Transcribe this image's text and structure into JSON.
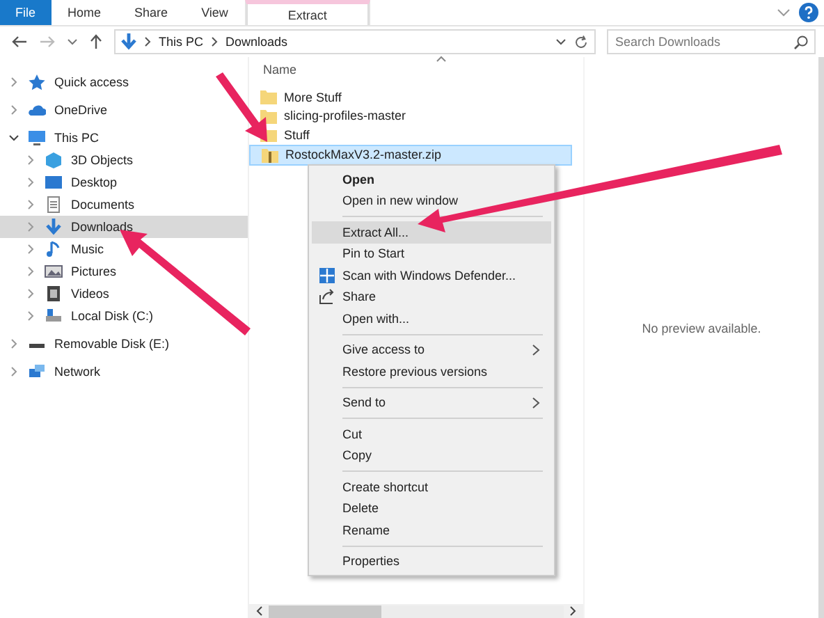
{
  "ribbon_tabs": [
    {
      "label": "File",
      "kind": "file",
      "selected": false
    },
    {
      "label": "Home",
      "kind": "tab",
      "selected": false
    },
    {
      "label": "Share",
      "kind": "tab",
      "selected": false
    },
    {
      "label": "View",
      "kind": "tab",
      "selected": false
    },
    {
      "label": "Extract",
      "kind": "contextual",
      "selected": true
    }
  ],
  "address_bar": {
    "path": [
      "This PC",
      "Downloads"
    ]
  },
  "search": {
    "placeholder": "Search Downloads"
  },
  "nav_pane": {
    "items": [
      {
        "label": "Quick access",
        "expanded": false,
        "selected": false
      },
      {
        "label": "OneDrive",
        "expanded": false,
        "selected": false
      },
      {
        "label": "This PC",
        "expanded": true,
        "selected": false,
        "children": [
          {
            "label": "3D Objects",
            "expanded": false,
            "selected": false
          },
          {
            "label": "Desktop",
            "expanded": false,
            "selected": false
          },
          {
            "label": "Documents",
            "expanded": false,
            "selected": false
          },
          {
            "label": "Downloads",
            "expanded": false,
            "selected": true
          },
          {
            "label": "Music",
            "expanded": false,
            "selected": false
          },
          {
            "label": "Pictures",
            "expanded": false,
            "selected": false
          },
          {
            "label": "Videos",
            "expanded": false,
            "selected": false
          },
          {
            "label": "Local Disk (C:)",
            "expanded": false,
            "selected": false
          }
        ]
      },
      {
        "label": "Removable Disk (E:)",
        "expanded": false,
        "selected": false
      },
      {
        "label": "Network",
        "expanded": false,
        "selected": false
      }
    ]
  },
  "file_list": {
    "column": "Name",
    "files": [
      {
        "name": "More Stuff",
        "kind": "folder",
        "selected": false
      },
      {
        "name": "slicing-profiles-master",
        "kind": "folder",
        "selected": false
      },
      {
        "name": "Stuff",
        "kind": "folder",
        "selected": false
      },
      {
        "name": "RostockMaxV3.2-master.zip",
        "kind": "zip",
        "selected": true
      }
    ]
  },
  "context_menu": {
    "items": [
      {
        "kind": "item",
        "label": "Open",
        "bold": true,
        "selected": false
      },
      {
        "kind": "item",
        "label": "Open in new window",
        "bold": false,
        "selected": false
      },
      {
        "kind": "separator"
      },
      {
        "kind": "item",
        "label": "Extract All...",
        "bold": false,
        "selected": true
      },
      {
        "kind": "item",
        "label": "Pin to Start",
        "bold": false,
        "selected": false
      },
      {
        "kind": "item",
        "label": "Scan with Windows Defender...",
        "bold": false,
        "selected": false
      },
      {
        "kind": "item",
        "label": "Share",
        "bold": false,
        "selected": false
      },
      {
        "kind": "item",
        "label": "Open with...",
        "bold": false,
        "selected": false
      },
      {
        "kind": "separator"
      },
      {
        "kind": "submenu",
        "label": "Give access to",
        "bold": false,
        "selected": false
      },
      {
        "kind": "item",
        "label": "Restore previous versions",
        "bold": false,
        "selected": false
      },
      {
        "kind": "separator"
      },
      {
        "kind": "submenu",
        "label": "Send to",
        "bold": false,
        "selected": false
      },
      {
        "kind": "separator"
      },
      {
        "kind": "item",
        "label": "Cut",
        "bold": false,
        "selected": false
      },
      {
        "kind": "item",
        "label": "Copy",
        "bold": false,
        "selected": false
      },
      {
        "kind": "separator"
      },
      {
        "kind": "item",
        "label": "Create shortcut",
        "bold": false,
        "selected": false
      },
      {
        "kind": "item",
        "label": "Delete",
        "bold": false,
        "selected": false
      },
      {
        "kind": "item",
        "label": "Rename",
        "bold": false,
        "selected": false
      },
      {
        "kind": "separator"
      },
      {
        "kind": "item",
        "label": "Properties",
        "bold": false,
        "selected": false
      }
    ]
  },
  "preview_pane": {
    "message": "No preview available."
  }
}
